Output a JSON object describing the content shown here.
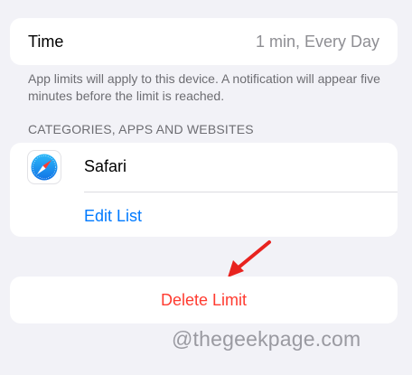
{
  "time_row": {
    "label": "Time",
    "value": "1 min, Every Day"
  },
  "footer_note": "App limits will apply to this device. A notification will appear five minutes before the limit is reached.",
  "section_header": "CATEGORIES, APPS AND WEBSITES",
  "apps": {
    "items": [
      {
        "name": "Safari",
        "icon": "safari-compass-icon"
      }
    ],
    "edit_label": "Edit List"
  },
  "delete_label": "Delete Limit",
  "watermark": "@thegeekpage.com",
  "colors": {
    "background": "#f2f2f7",
    "card": "#ffffff",
    "link_blue": "#007aff",
    "destructive_red": "#ff3b30",
    "secondary_text": "#8e8e93",
    "annotation_arrow": "#e8231f"
  }
}
